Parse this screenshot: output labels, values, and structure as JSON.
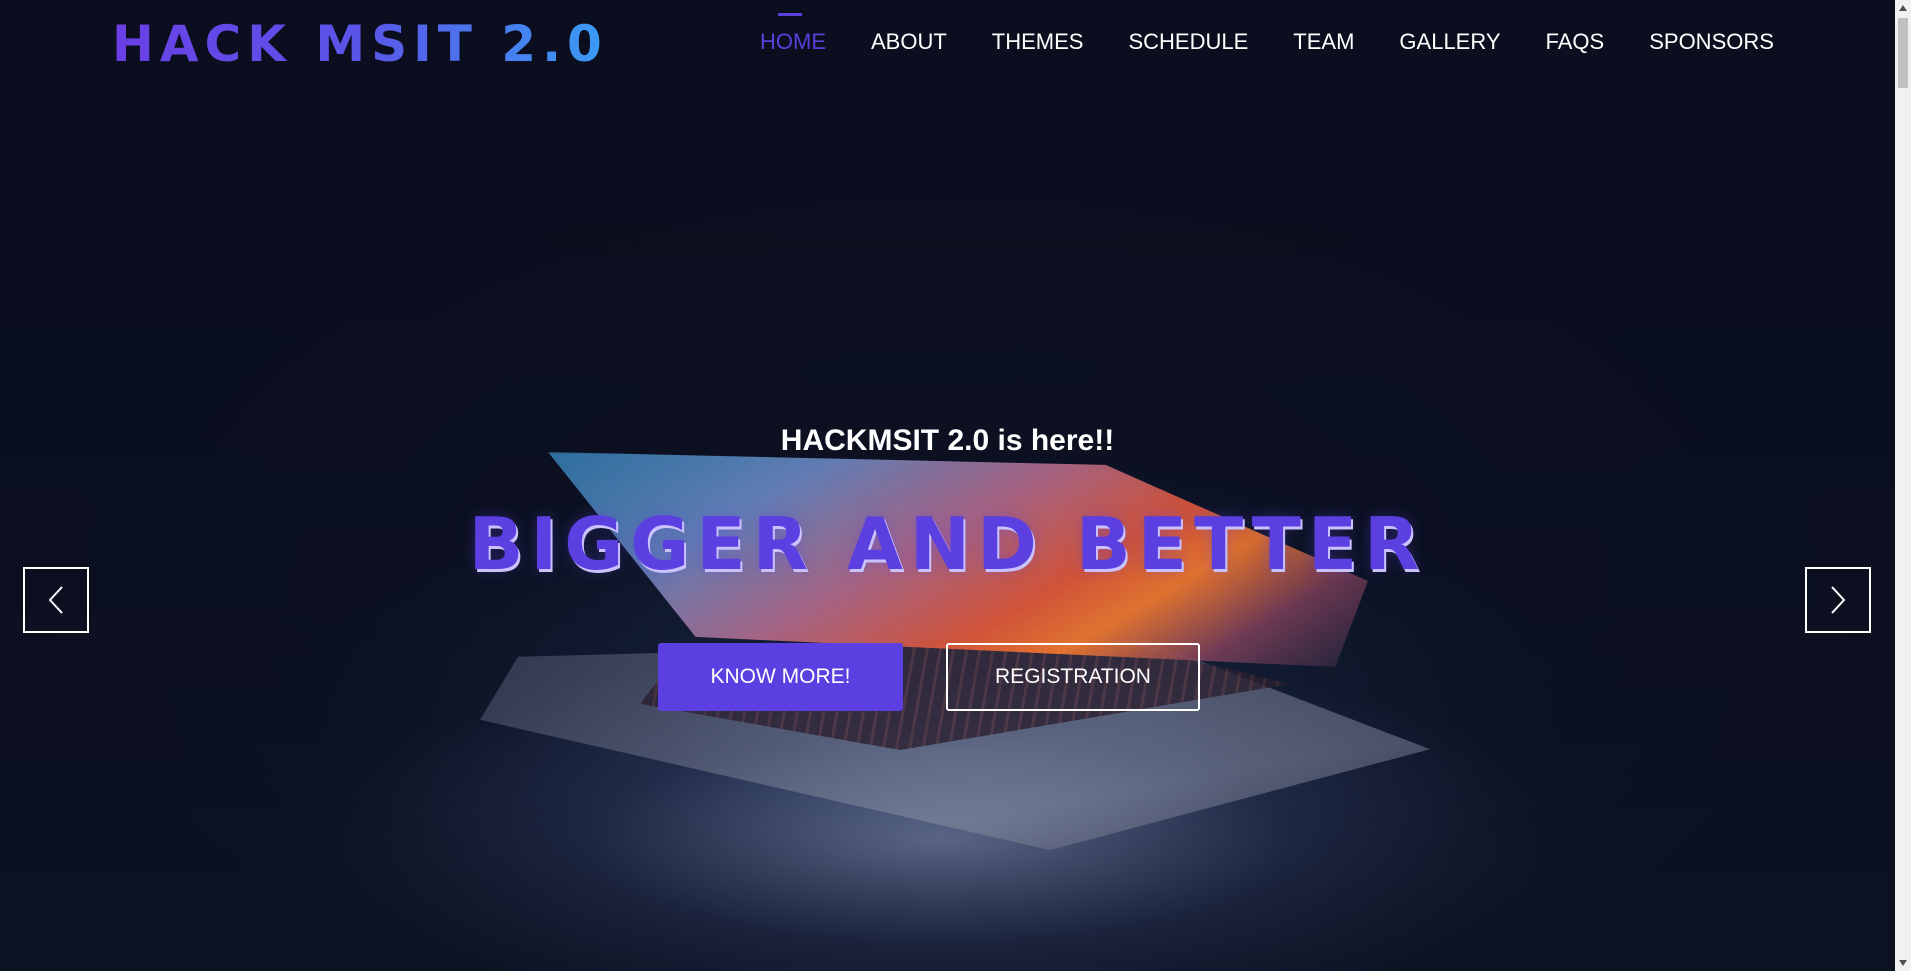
{
  "header": {
    "logo_text": "HACK MSIT 2.0",
    "nav": [
      {
        "label": "HOME",
        "active": true
      },
      {
        "label": "ABOUT"
      },
      {
        "label": "THEMES"
      },
      {
        "label": "SCHEDULE"
      },
      {
        "label": "TEAM"
      },
      {
        "label": "GALLERY"
      },
      {
        "label": "FAQS"
      },
      {
        "label": "SPONSORS"
      }
    ]
  },
  "hero": {
    "subtitle": "HACKMSIT 2.0 is here!!",
    "title": "BIGGER AND BETTER",
    "primary_button": "KNOW MORE!",
    "secondary_button": "REGISTRATION",
    "prev_icon": "chevron-left-icon",
    "next_icon": "chevron-right-icon"
  },
  "colors": {
    "accent": "#5b3fe0",
    "background": "#0b0f1f",
    "text": "#ffffff"
  }
}
